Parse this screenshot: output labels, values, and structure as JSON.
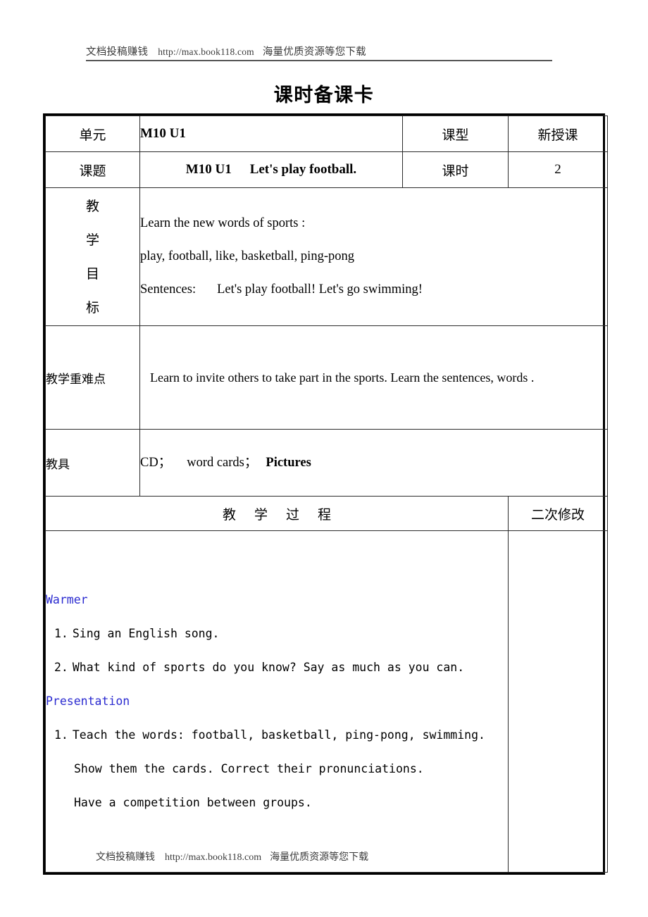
{
  "running_header": {
    "left_cn": "文档投稿赚钱",
    "url": "http://max.book118.com",
    "right_cn": "海量优质资源等您下载"
  },
  "running_footer": {
    "left_cn": "文档投稿赚钱",
    "url": "http://max.book118.com",
    "right_cn": "海量优质资源等您下载"
  },
  "doc_title": "课时备课卡",
  "table": {
    "row_unit": {
      "label": "单元",
      "value": "M10 U1",
      "label2": "课型",
      "value2": "新授课"
    },
    "row_topic": {
      "label": "课题",
      "value_code": "M10 U1",
      "value_text": "Let's play football.",
      "label2": "课时",
      "value2": "2"
    },
    "row_goals": {
      "label_chars": [
        "教",
        "学",
        "目",
        "标"
      ],
      "lines": [
        "Learn the new words of sports :",
        "play, football, like, basketball, ping-pong"
      ],
      "sentence_label": "Sentences:",
      "sentence_text": "Let's play football! Let's go swimming!"
    },
    "row_focus": {
      "label": "教学重难点",
      "text": "Learn to invite others to take part in the sports. Learn the sentences, words ."
    },
    "row_aids": {
      "label": "教具",
      "part1": "CD；",
      "part2": "word cards；",
      "part3": "Pictures"
    },
    "row_process_head": {
      "label": "教 学 过 程",
      "label2": "二次修改"
    },
    "process_body": {
      "sections": [
        {
          "title": "Warmer",
          "items": [
            {
              "num": "1.",
              "text": "Sing an English song.",
              "justify": false
            },
            {
              "num": "2.",
              "text": "What kind of sports do you know? Say as much as you can.",
              "justify": true
            }
          ],
          "continuations": []
        },
        {
          "title": "Presentation",
          "items": [
            {
              "num": "1.",
              "text": "Teach the words: football, basketball, ping-pong, swimming.",
              "justify": true
            }
          ],
          "continuations": [
            "Show them the cards. Correct their pronunciations.",
            "Have a competition between groups."
          ]
        }
      ]
    }
  }
}
